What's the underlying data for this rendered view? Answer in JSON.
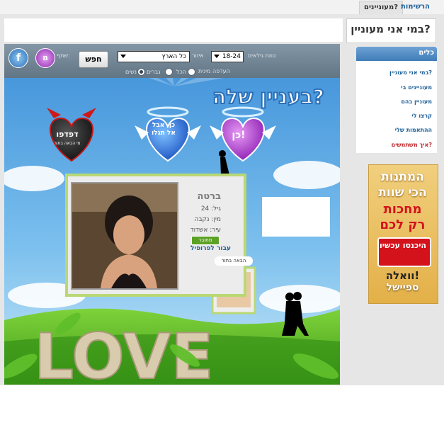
{
  "tabs": [
    {
      "label": "מעוניינים?"
    },
    {
      "label": "הרשימות שלי"
    }
  ],
  "page_title": "במי אני מעוניין?",
  "sidebar": {
    "header": "כלים",
    "items": [
      {
        "label": "במי אני מעוניין?"
      },
      {
        "label": "מעוניינים בי"
      },
      {
        "label": "מעוניין בהם"
      },
      {
        "label": "קרצו לי"
      },
      {
        "label": "ההתאמות שלי"
      },
      {
        "label": "איך משתמשים?"
      }
    ]
  },
  "ad": {
    "line1": "המתנות",
    "line2": "הכי שוות",
    "line3": "מחכות",
    "line4": "רק לכם",
    "button": "היכנסו עכשיו",
    "brand1": "וואלה!",
    "brand2": "ספיישל"
  },
  "game": {
    "age_label": "טווח גילאים",
    "age_value": "18-24",
    "area_label": "איזור",
    "area_value": "כל הארץ",
    "search_button": "חפש",
    "share_label": "שתף:",
    "pref_label": "העדפה מינית",
    "pref_options": [
      "הכל",
      "גברים",
      "נשים"
    ],
    "title": "בעניין שלה?",
    "vote_yes": "כן!",
    "vote_maybe": "כן, אבל אל תגלו",
    "vote_next": "דפדפו",
    "vote_next_sub": "מי הבאה בתור",
    "profile": {
      "name": "ברטה",
      "age": "גיל: 24",
      "gender": "מין: נקבה",
      "city": "עיר: אשדוד",
      "online": "מחובר",
      "link": "עבור לפרופיל"
    },
    "next_label": "הבאה בתור",
    "love_text": "LOVE"
  }
}
